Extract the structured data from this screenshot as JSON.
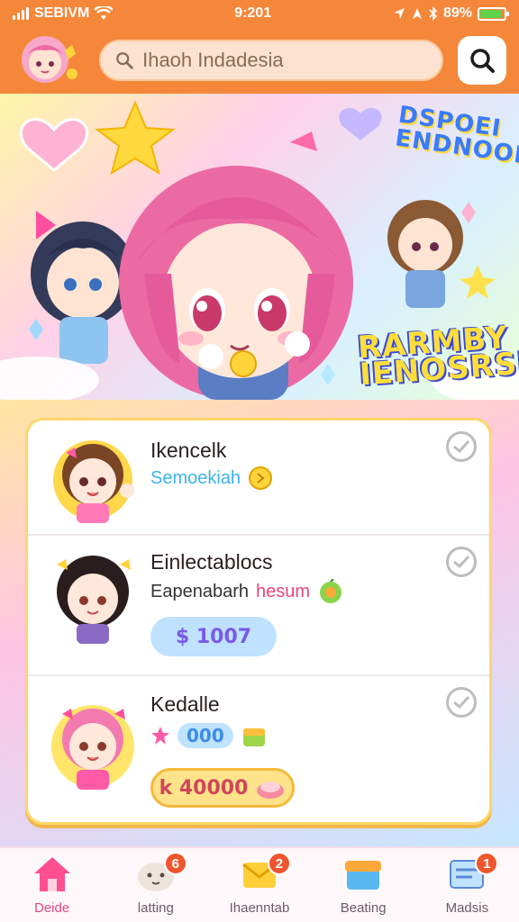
{
  "status_bar": {
    "carrier": "SEBIVM",
    "time": "9:201",
    "battery": "89%",
    "battery_level": 0.89
  },
  "header": {
    "search_placeholder": "Ihaoh Indadesia"
  },
  "hero": {
    "badge_top": "DSPOEI ENDNOOHSKS",
    "badge_bottom": "RARMBY IENOSRSEI!"
  },
  "cards": [
    {
      "title": "Ikencelk",
      "subtitle": "Semoekiah",
      "subtitle_color": "#3bb3e8"
    },
    {
      "title": "Einlectablocs",
      "subtitle_a": "Eapenabarh",
      "subtitle_b": "hesum",
      "price": "$ 1007"
    },
    {
      "title": "Kedalle",
      "count": "000",
      "price": "k 40000"
    }
  ],
  "nav": [
    {
      "label": "Deide",
      "icon": "home-icon",
      "badge": ""
    },
    {
      "label": "latting",
      "icon": "pet-icon",
      "badge": "6"
    },
    {
      "label": "Ihaenntab",
      "icon": "mail-icon",
      "badge": "2"
    },
    {
      "label": "Beating",
      "icon": "box-icon",
      "badge": ""
    },
    {
      "label": "Madsis",
      "icon": "message-icon",
      "badge": "1"
    }
  ],
  "colors": {
    "accent": "#f5873a",
    "active": "#e9457f",
    "badge": "#f0562e"
  }
}
